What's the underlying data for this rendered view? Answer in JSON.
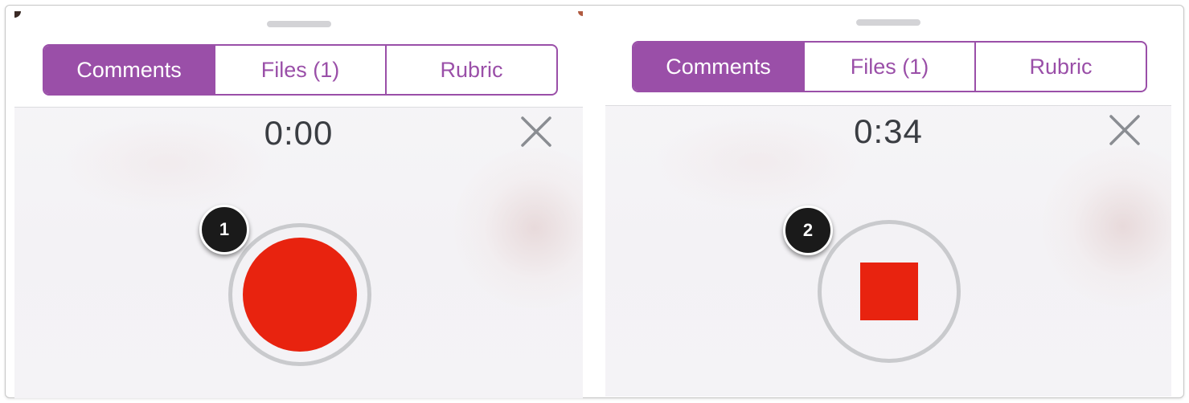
{
  "left_panel": {
    "tabs": [
      {
        "label": "Comments",
        "active": true
      },
      {
        "label": "Files (1)",
        "active": false
      },
      {
        "label": "Rubric",
        "active": false
      }
    ],
    "timer": "0:00",
    "action": "record",
    "close_icon": "close-icon"
  },
  "right_panel": {
    "tabs": [
      {
        "label": "Comments",
        "active": true
      },
      {
        "label": "Files (1)",
        "active": false
      },
      {
        "label": "Rubric",
        "active": false
      }
    ],
    "timer": "0:34",
    "action": "stop",
    "close_icon": "close-icon"
  },
  "callouts": [
    {
      "number": "1"
    },
    {
      "number": "2"
    }
  ],
  "colors": {
    "accent": "#9a4fa8",
    "record": "#e8230f",
    "ring": "#c9cacd",
    "badge": "#1a1a1a"
  }
}
